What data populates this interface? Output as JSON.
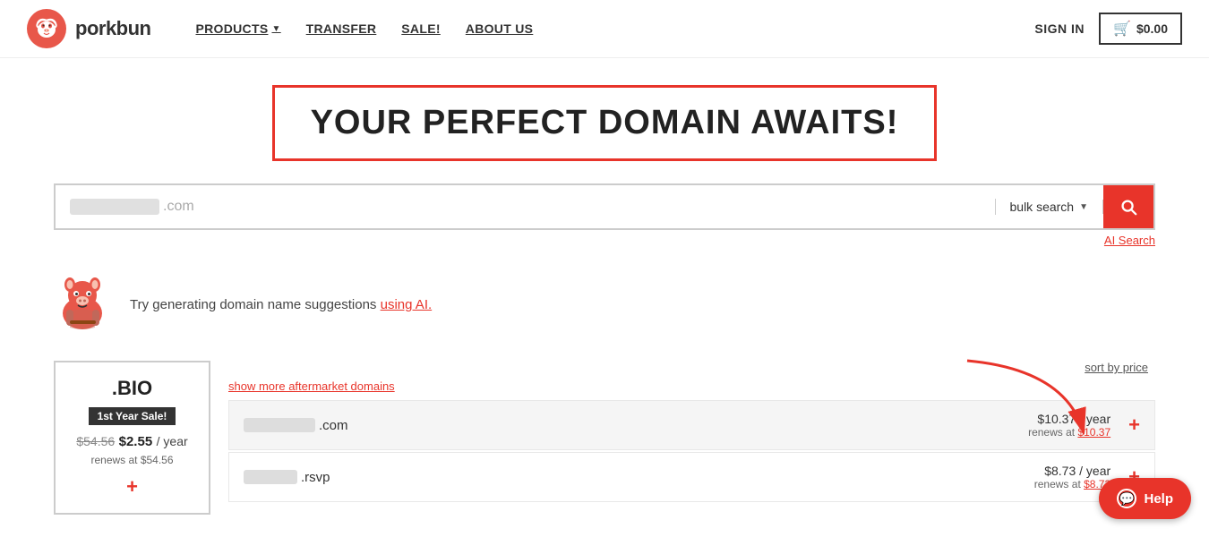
{
  "header": {
    "logo_text": "porkbun",
    "logo_icon": "🐷",
    "nav_items": [
      {
        "label": "PRODUCTS",
        "has_dropdown": true
      },
      {
        "label": "TRANSFER",
        "has_dropdown": false
      },
      {
        "label": "SALE!",
        "has_dropdown": false
      },
      {
        "label": "ABOUT US",
        "has_dropdown": false
      }
    ],
    "sign_in_label": "SIGN IN",
    "cart_label": "$0.00"
  },
  "hero": {
    "title": "YOUR PERFECT DOMAIN AWAITS!"
  },
  "search": {
    "domain_suffix": ".com",
    "bulk_search_label": "bulk search",
    "search_button_label": "Search",
    "ai_search_label": "AI Search"
  },
  "ai_suggestion": {
    "text": "Try generating domain name suggestions ",
    "link_text": "using AI."
  },
  "results": {
    "sort_label": "sort by price",
    "show_more_label": "show more aftermarket domains",
    "tld_card": {
      "name": ".BIO",
      "badge": "1st Year Sale!",
      "old_price": "$54.56",
      "new_price": "$2.55",
      "per_year": "/ year",
      "renews": "renews at $54.56",
      "add_label": "+"
    },
    "domains": [
      {
        "ext": ".com",
        "price": "$10.37 / year",
        "renews": "renews at $10.37",
        "add_label": "+"
      },
      {
        "ext": ".rsvp",
        "price": "$8.73 / year",
        "renews": "renews at $8.73",
        "add_label": "+"
      }
    ]
  },
  "help": {
    "label": "Help"
  }
}
